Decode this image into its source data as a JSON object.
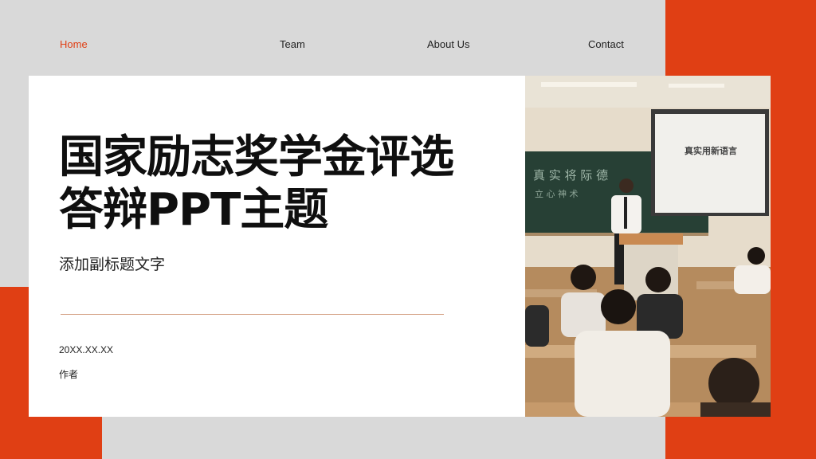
{
  "nav": {
    "items": [
      {
        "label": "Home",
        "active": true
      },
      {
        "label": "Team",
        "active": false
      },
      {
        "label": "About Us",
        "active": false
      },
      {
        "label": "Contact",
        "active": false
      }
    ]
  },
  "hero": {
    "title_line1": "国家励志奖学金评选",
    "title_line2": "答辩PPT主题",
    "subtitle": "添加副标题文字",
    "date": "20XX.XX.XX",
    "author": "作者"
  },
  "colors": {
    "accent": "#e03f14",
    "background": "#d9d9d9",
    "card": "#ffffff"
  },
  "image": {
    "subject": "classroom presentation photo",
    "projector_text": "真实用新语言"
  }
}
